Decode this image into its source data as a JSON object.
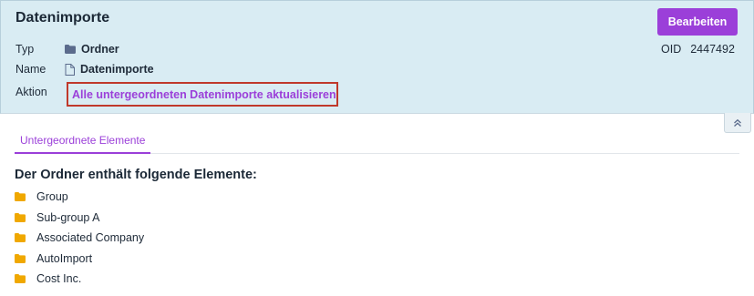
{
  "header": {
    "title": "Datenimporte",
    "edit_label": "Bearbeiten",
    "oid_label": "OID",
    "oid_value": "2447492",
    "type_label": "Typ",
    "type_value": "Ordner",
    "name_label": "Name",
    "name_value": "Datenimporte",
    "action_label": "Aktion",
    "action_value": "Alle untergeordneten Datenimporte aktualisieren"
  },
  "tabs": [
    {
      "label": "Untergeordnete Elemente"
    }
  ],
  "content": {
    "title": "Der Ordner enthält folgende Elemente:",
    "items": [
      {
        "label": "Group"
      },
      {
        "label": "Sub-group A"
      },
      {
        "label": "Associated Company"
      },
      {
        "label": "AutoImport"
      },
      {
        "label": "Cost Inc."
      }
    ]
  },
  "colors": {
    "accent": "#9b3fd9",
    "header_bg": "#d9ecf3",
    "folder": "#f0a800",
    "highlight_border": "#c0392b"
  },
  "icons": {
    "type": "folder-icon",
    "name": "file-icon",
    "collapse": "double-chevron-up-icon",
    "item": "folder-icon"
  }
}
